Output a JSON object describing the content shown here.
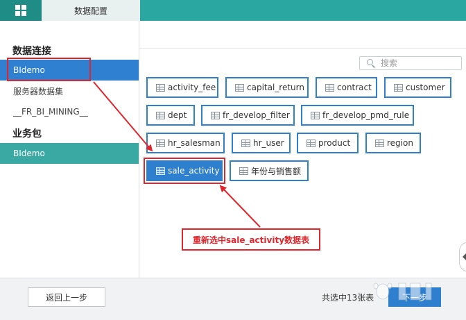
{
  "header": {
    "menu_icon": "grid-icon",
    "tab_label": "数据配置"
  },
  "sidebar": {
    "section_connection": "数据连接",
    "connection_items": [
      {
        "label": "BIdemo",
        "selected": true
      },
      {
        "label": "服务器数据集",
        "selected": false
      },
      {
        "label": "__FR_BI_MINING__",
        "selected": false
      }
    ],
    "section_package": "业务包",
    "package_items": [
      {
        "label": "BIdemo",
        "selected": true
      }
    ]
  },
  "search": {
    "placeholder": "搜索",
    "icon": "search-icon"
  },
  "tables": [
    {
      "label": "activity_fee",
      "selected": false
    },
    {
      "label": "capital_return",
      "selected": false
    },
    {
      "label": "contract",
      "selected": false
    },
    {
      "label": "customer",
      "selected": false
    },
    {
      "label": "dept",
      "selected": false
    },
    {
      "label": "fr_develop_filter",
      "selected": false
    },
    {
      "label": "fr_develop_pmd_rule",
      "selected": false
    },
    {
      "label": "hr_salesman",
      "selected": false
    },
    {
      "label": "hr_user",
      "selected": false
    },
    {
      "label": "product",
      "selected": false
    },
    {
      "label": "region",
      "selected": false
    },
    {
      "label": "sale_activity",
      "selected": true
    },
    {
      "label": "年份与销售额",
      "selected": false
    }
  ],
  "annotation": {
    "callout_text": "重新选中sale_activity数据表",
    "color": "#e1262b"
  },
  "footer": {
    "back_label": "返回上一步",
    "count_text": "共选中13张表",
    "next_label": "下一步"
  },
  "colors": {
    "teal": "#2aa7a0",
    "blue": "#2f7fcf"
  }
}
